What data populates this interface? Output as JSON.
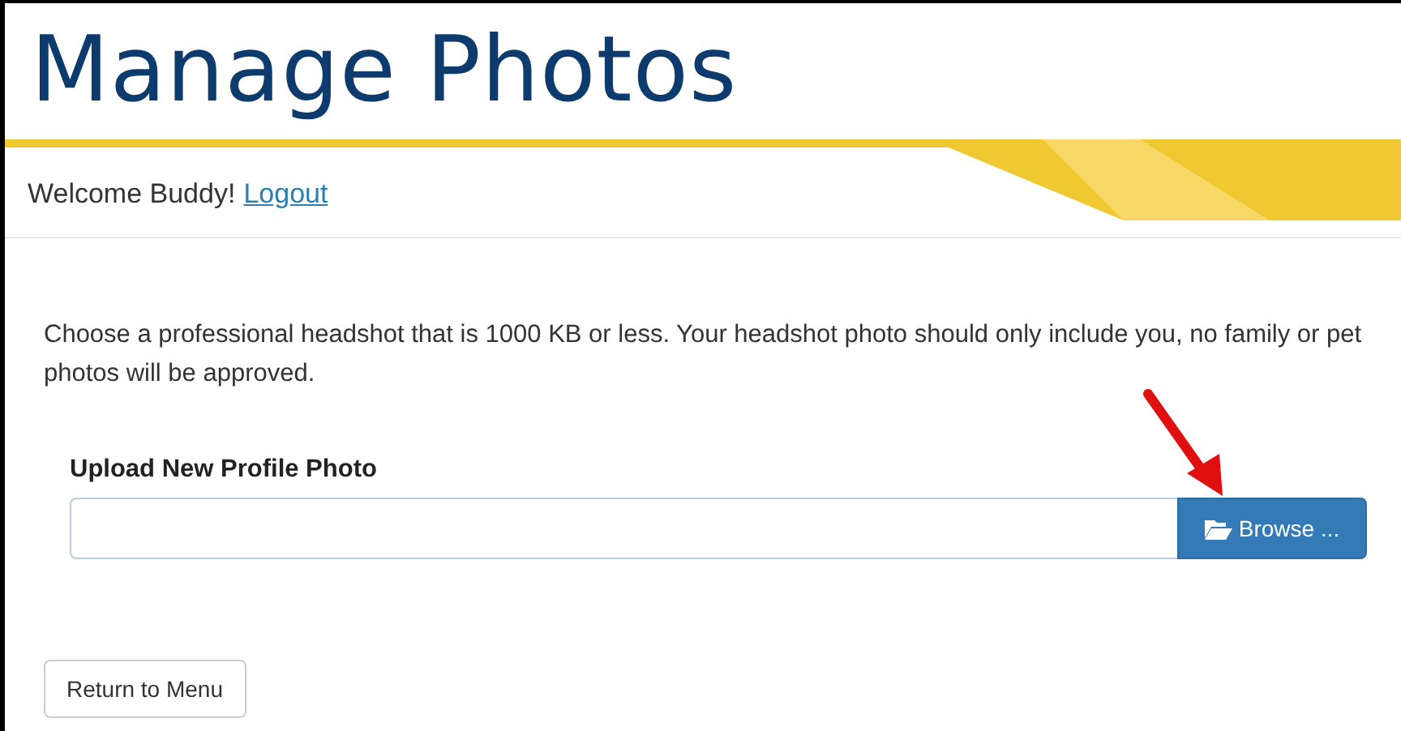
{
  "title": "Manage Photos",
  "welcome": {
    "text": "Welcome Buddy!",
    "link": "Logout"
  },
  "instructions": "Choose a professional headshot that is 1000 KB or less. Your headshot photo should only include you, no family or pet photos will be approved.",
  "upload": {
    "label": "Upload New Profile Photo",
    "button": "Browse ..."
  },
  "buttons": [
    "Return to Menu"
  ]
}
